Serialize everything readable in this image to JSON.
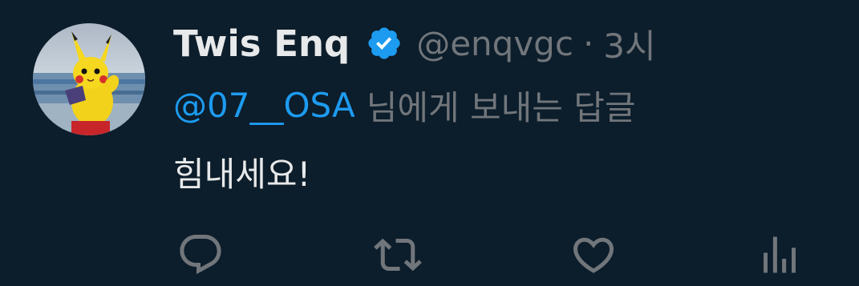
{
  "tweet": {
    "display_name": "Twis Enq",
    "handle": "@enqvgc",
    "separator": "·",
    "time": "3시",
    "reply_mention": "@07__OSA",
    "reply_suffix": "님에게 보내는 답글",
    "text": "힘내세요!"
  },
  "icons": {
    "verified": "verified-badge-icon",
    "reply": "reply-icon",
    "retweet": "retweet-icon",
    "like": "like-icon",
    "views": "views-icon"
  },
  "colors": {
    "background": "#0c1d2b",
    "primary_text": "#e7e9ea",
    "secondary_text": "#71767b",
    "accent": "#1d9bf0"
  }
}
